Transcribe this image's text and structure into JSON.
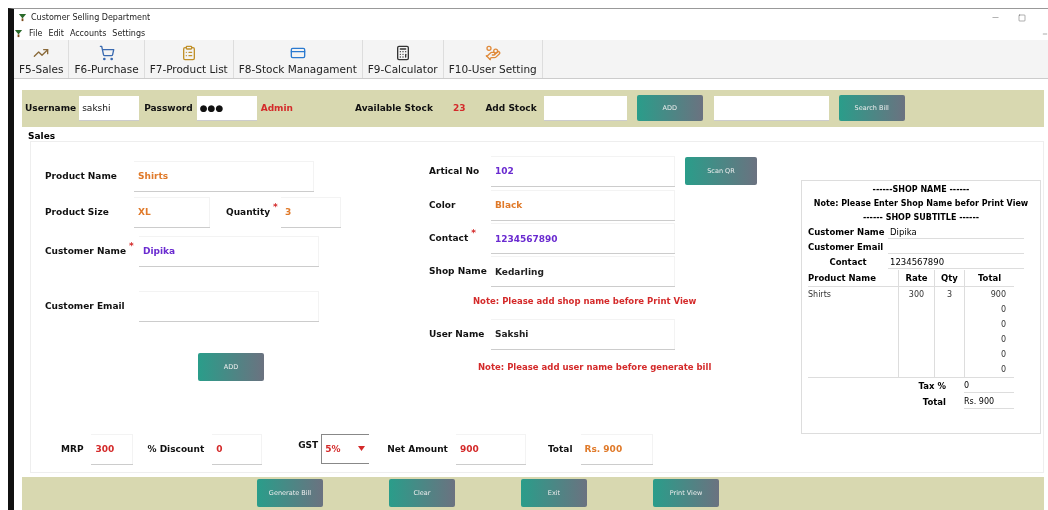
{
  "window": {
    "title": "Customer Selling Department"
  },
  "menu": [
    "File",
    "Edit",
    "Accounts",
    "Settings"
  ],
  "toolbar": [
    {
      "label": "F5-Sales"
    },
    {
      "label": "F6-Purchase"
    },
    {
      "label": "F7-Product List"
    },
    {
      "label": "F8-Stock Managament"
    },
    {
      "label": "F9-Calculator"
    },
    {
      "label": "F10-User Setting"
    }
  ],
  "login_bar": {
    "username_label": "Username",
    "username": "sakshi",
    "password_label": "Password",
    "password": "●●●",
    "role": "Admin",
    "stock_label": "Available Stock",
    "stock": "23",
    "add_stock_label": "Add Stock",
    "add_button": "ADD",
    "search_button": "Search Bill"
  },
  "sales": {
    "title": "Sales",
    "left_fields": [
      {
        "label": "Product Name",
        "value": "Shirts",
        "color": "#e07a2a"
      },
      {
        "label": "Product Size",
        "value": "XL",
        "color": "#e07a2a"
      },
      {
        "label": "Quantity",
        "value": "3",
        "color": "#e07a2a",
        "required_mark": "*"
      },
      {
        "label": "Customer Name",
        "value": "Dipika",
        "color": "#6a2bd0",
        "required_mark": "*"
      },
      {
        "label": "Customer Email"
      }
    ],
    "add_button": "ADD",
    "right_fields": [
      {
        "label": "Artical No",
        "value": "102",
        "color": "#6a2bd0"
      },
      {
        "label": "Color",
        "value": "Black",
        "color": "#e07a2a"
      },
      {
        "label": "Contact",
        "value": "1234567890",
        "color": "#6a2bd0",
        "required_mark": "*"
      },
      {
        "label": "Shop Name",
        "value": "Kedarling",
        "color": "#222222"
      },
      {
        "label": "User Name",
        "value": "Sakshi",
        "color": "#222222"
      }
    ],
    "scan_button": "Scan QR",
    "shop_note": "Note: Please add shop name before Print View",
    "user_note": "Note: Please add user name before generate bill",
    "totals": [
      {
        "label": "MRP",
        "value": "300",
        "color": "#d42a2a",
        "kind": "field"
      },
      {
        "label": "% Discount",
        "value": "0",
        "color": "#d42a2a",
        "kind": "field"
      },
      {
        "label": "GST",
        "value": "5%",
        "color": "#d42a2a",
        "kind": "select"
      },
      {
        "label": "Net Amount",
        "value": "900",
        "color": "#d42a2a",
        "kind": "field"
      },
      {
        "label": "Total",
        "value": "Rs. 900",
        "color": "#e07a2a",
        "kind": "field"
      }
    ]
  },
  "receipt": {
    "heading": "------SHOP NAME ------",
    "note": "Note: Please Enter Shop Name befor Print View",
    "subtitle": "------ SHOP SUBTITLE  ------",
    "customer": [
      {
        "label": "Customer Name",
        "value": "Dipika"
      },
      {
        "label": "Customer Email"
      },
      {
        "label": "Contact",
        "value": "1234567890"
      }
    ],
    "columns": [
      "Product Name",
      "Rate",
      "Qty",
      "Total"
    ],
    "rows": [
      [
        "Shirts",
        "300",
        "3",
        "900"
      ],
      [
        null,
        null,
        null,
        "0"
      ],
      [
        null,
        null,
        null,
        "0"
      ],
      [
        null,
        null,
        null,
        "0"
      ],
      [
        null,
        null,
        null,
        "0"
      ],
      [
        null,
        null,
        null,
        "0"
      ]
    ],
    "tax_label": "Tax %",
    "tax": "0",
    "total_label": "Total",
    "total": "Rs. 900"
  },
  "actions": [
    "Generate Bill",
    "Clear",
    "Exit",
    "Print View"
  ]
}
